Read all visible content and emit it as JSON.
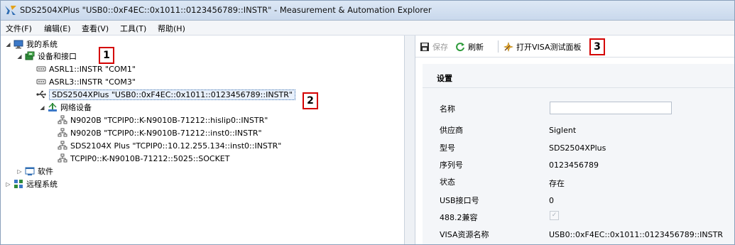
{
  "window": {
    "title": "SDS2504XPlus \"USB0::0xF4EC::0x1011::0123456789::INSTR\" - Measurement & Automation Explorer"
  },
  "menu": [
    {
      "label": "文件(F)"
    },
    {
      "label": "编辑(E)"
    },
    {
      "label": "查看(V)"
    },
    {
      "label": "工具(T)"
    },
    {
      "label": "帮助(H)"
    }
  ],
  "tree": {
    "my_system": "我的系统",
    "devices": "设备和接口",
    "asrl1": "ASRL1::INSTR \"COM1\"",
    "asrl3": "ASRL3::INSTR \"COM3\"",
    "usb_device": "SDS2504XPlus \"USB0::0xF4EC::0x1011::0123456789::INSTR\"",
    "network_devices": "网络设备",
    "net_items": [
      "N9020B \"TCPIP0::K-N9010B-71212::hislip0::INSTR\"",
      "N9020B \"TCPIP0::K-N9010B-71212::inst0::INSTR\"",
      "SDS2104X Plus \"TCPIP0::10.12.255.134::inst0::INSTR\"",
      "TCPIP0::K-N9010B-71212::5025::SOCKET"
    ],
    "software": "软件",
    "remote_systems": "远程系统"
  },
  "badges": [
    "1",
    "2",
    "3"
  ],
  "toolbar": {
    "save_label": "保存",
    "refresh_label": "刷新",
    "open_visa_label": "打开VISA测试面板"
  },
  "settings": {
    "title": "设置",
    "labels": {
      "name": "名称",
      "vendor": "供应商",
      "model": "型号",
      "serial": "序列号",
      "status": "状态",
      "usb_interface": "USB接口号",
      "compliant": "488.2兼容",
      "visa_name": "VISA资源名称"
    },
    "values": {
      "name": "",
      "vendor": "Siglent",
      "model": "SDS2504XPlus",
      "serial": "0123456789",
      "status": "存在",
      "usb_interface": "0",
      "compliant_checked": true,
      "visa_name": "USB0::0xF4EC::0x1011::0123456789::INSTR"
    }
  },
  "colors": {
    "badge_border": "#d40000",
    "selection_border": "#3a6fb0",
    "panel_bg": "#f4f6f9"
  }
}
